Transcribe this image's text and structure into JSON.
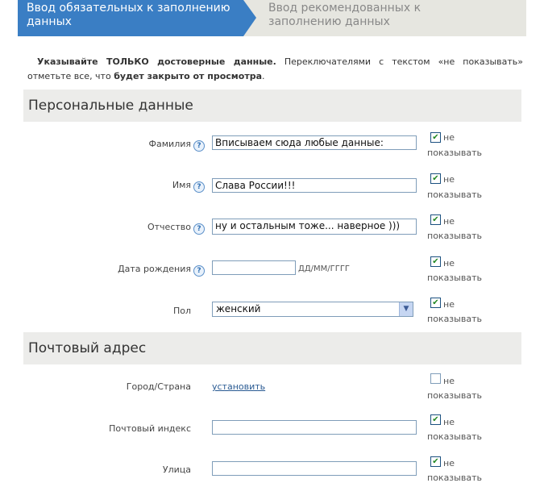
{
  "tabs": {
    "active": "Ввод обязательных к заполнению данных",
    "inactive": "Ввод рекомендованных к заполнению данных"
  },
  "intro": {
    "p1_bold": "Указывайте ТОЛЬКО достоверные данные.",
    "p1_rest": " Переключателями с текстом «не показывать» отметьте все, что ",
    "p1_bold2": "будет закрыто от просмотра",
    "p1_end": "."
  },
  "sections": {
    "personal": "Персональные данные",
    "postal": "Почтовый адрес"
  },
  "fields": {
    "lastname": {
      "label": "Фамилия",
      "value": "Вписываем сюда любые данные:"
    },
    "firstname": {
      "label": "Имя",
      "value": "Слава России!!!"
    },
    "patronymic": {
      "label": "Отчество",
      "value": "ну и остальным тоже... наверное )))"
    },
    "birthdate": {
      "label": "Дата рождения",
      "value": "",
      "hint": "ДД/ММ/ГГГГ"
    },
    "gender": {
      "label": "Пол",
      "selected": "женский"
    },
    "city": {
      "label": "Город/Страна",
      "link": "установить"
    },
    "zip": {
      "label": "Почтовый индекс",
      "value": ""
    },
    "street": {
      "label": "Улица",
      "value": ""
    }
  },
  "hide": {
    "line1": "не",
    "line2": "показывать",
    "checked": {
      "lastname": true,
      "firstname": true,
      "patronymic": true,
      "birthdate": true,
      "gender": true,
      "city": false,
      "zip": true,
      "street": true
    }
  },
  "icons": {
    "help": "question-circle-icon",
    "dropdown": "chevron-down-icon",
    "check": "checkmark-icon"
  },
  "colors": {
    "active_tab": "#3a7ec4",
    "inactive_tab": "#e6e6e0",
    "section_bg": "#ececea",
    "link": "#2a5b93",
    "check": "#218721"
  }
}
